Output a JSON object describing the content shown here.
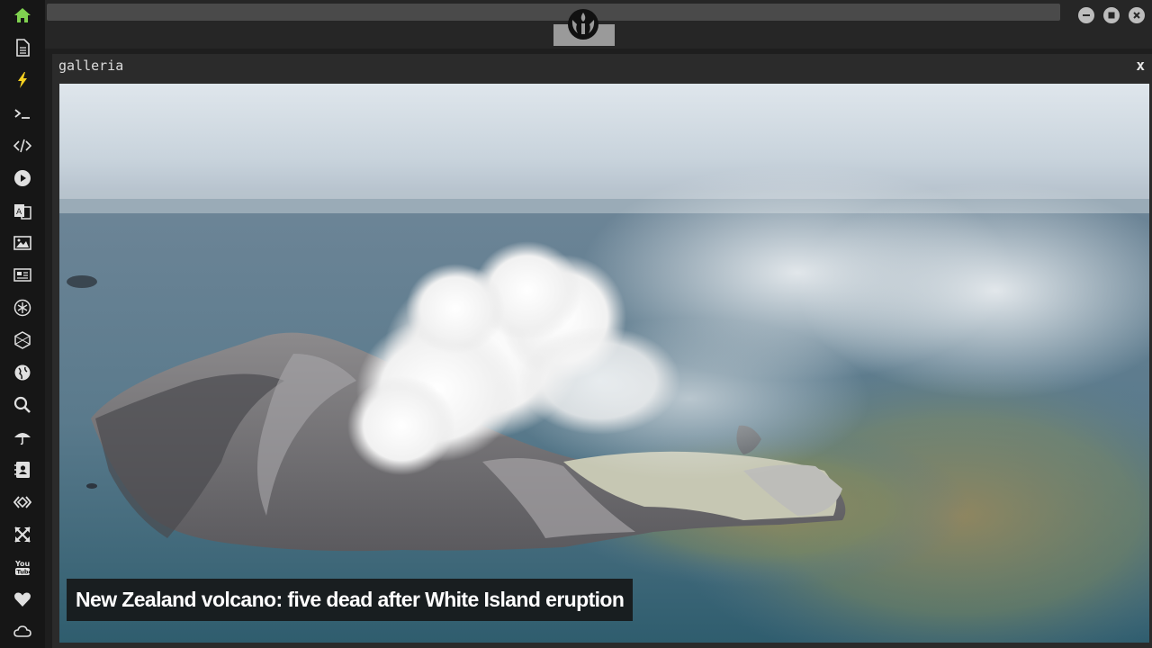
{
  "sidebar": {
    "items": [
      {
        "icon": "home-icon",
        "color": "#7fd14f"
      },
      {
        "icon": "document-icon"
      },
      {
        "icon": "lightning-icon",
        "color": "#f5d020"
      },
      {
        "icon": "terminal-icon"
      },
      {
        "icon": "code-icon"
      },
      {
        "icon": "play-icon"
      },
      {
        "icon": "translate-icon"
      },
      {
        "icon": "image-icon"
      },
      {
        "icon": "newspaper-icon"
      },
      {
        "icon": "rebel-icon"
      },
      {
        "icon": "hexagon-icon"
      },
      {
        "icon": "globe-icon"
      },
      {
        "icon": "search-icon"
      },
      {
        "icon": "umbrella-icon"
      },
      {
        "icon": "contacts-icon"
      },
      {
        "icon": "api-icon"
      },
      {
        "icon": "expand-icon"
      },
      {
        "icon": "youtube-icon"
      },
      {
        "icon": "heart-icon"
      },
      {
        "icon": "cloud-icon"
      }
    ]
  },
  "panel": {
    "title": "galleria",
    "close_label": "x"
  },
  "gallery": {
    "caption": "New Zealand volcano: five dead after White Island eruption"
  }
}
